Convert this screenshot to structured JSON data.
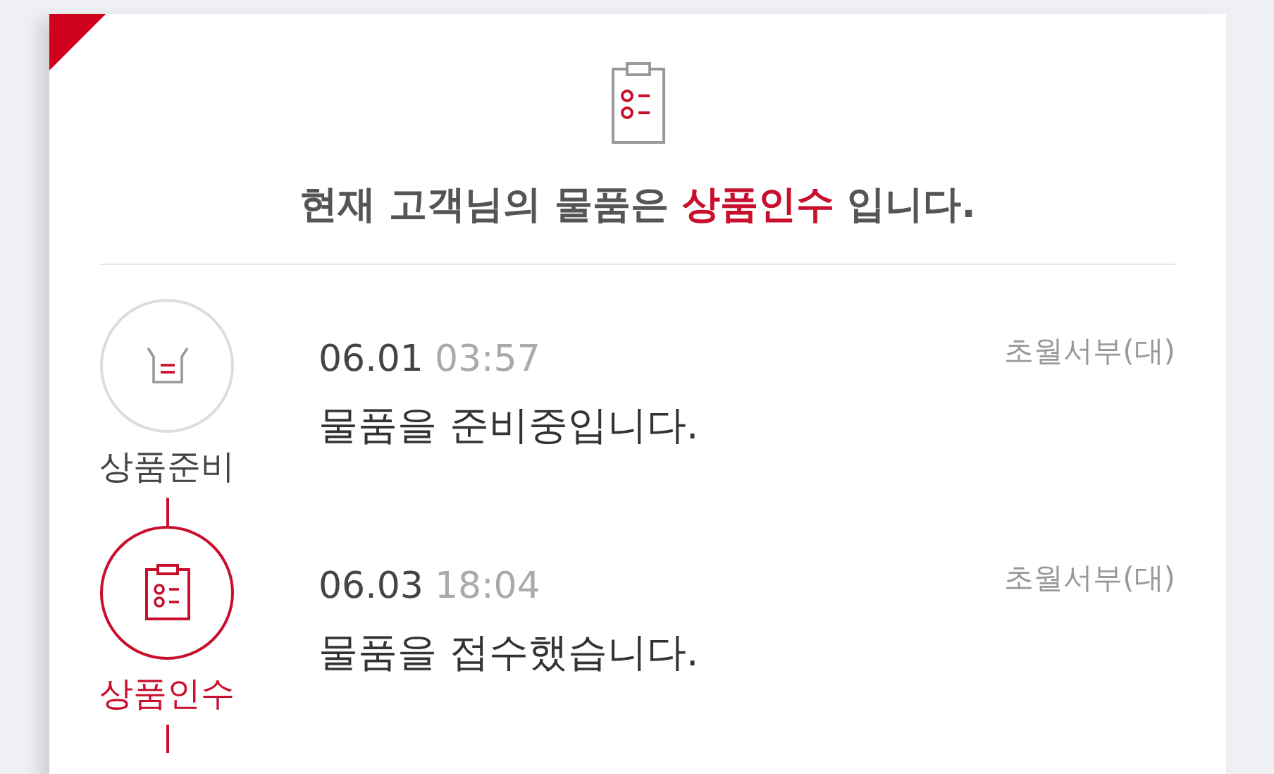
{
  "status_heading": {
    "prefix": "현재 고객님의 물품은",
    "status": "상품인수",
    "suffix": "입니다."
  },
  "steps": [
    {
      "kind": "prep",
      "label": "상품준비",
      "active": false,
      "date": "06.01",
      "time": "03:57",
      "message": "물품을 준비중입니다.",
      "location": "초월서부(대)"
    },
    {
      "kind": "received",
      "label": "상품인수",
      "active": true,
      "date": "06.03",
      "time": "18:04",
      "message": "물품을 접수했습니다.",
      "location": "초월서부(대)"
    }
  ]
}
